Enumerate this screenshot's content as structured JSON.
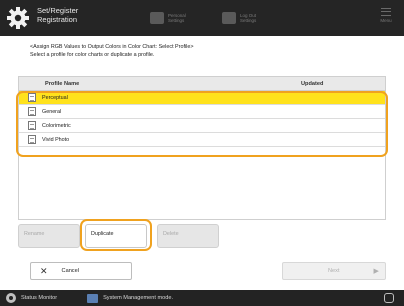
{
  "header": {
    "title": "Set/Register\nRegistration",
    "btn1_label": "Personal\nSettings",
    "btn2_label": "Log Out\nSettings",
    "menu_label": "Menu"
  },
  "instructions": "<Assign RGB Values to Output Colors in Color Chart: Select Profile>\nSelect a profile for color charts or duplicate a profile.",
  "table": {
    "col_profile_name": "Profile Name",
    "col_updated": "Updated",
    "rows": [
      {
        "name": "Perceptual",
        "updated": "",
        "selected": true
      },
      {
        "name": "General",
        "updated": "",
        "selected": false
      },
      {
        "name": "Colorimetric",
        "updated": "",
        "selected": false
      },
      {
        "name": "Vivid Photo",
        "updated": "",
        "selected": false
      }
    ]
  },
  "actions": {
    "rename_label": "Rename",
    "duplicate_label": "Duplicate",
    "delete_label": "Delete"
  },
  "footer": {
    "cancel_label": "Cancel",
    "next_label": "Next"
  },
  "status_bar": {
    "status_monitor_label": "Status Monitor",
    "system_mode_label": "System Management mode."
  },
  "colors": {
    "selection": "#ffe21c",
    "highlight_ring": "#f0a21f",
    "header_bg": "#252525"
  }
}
